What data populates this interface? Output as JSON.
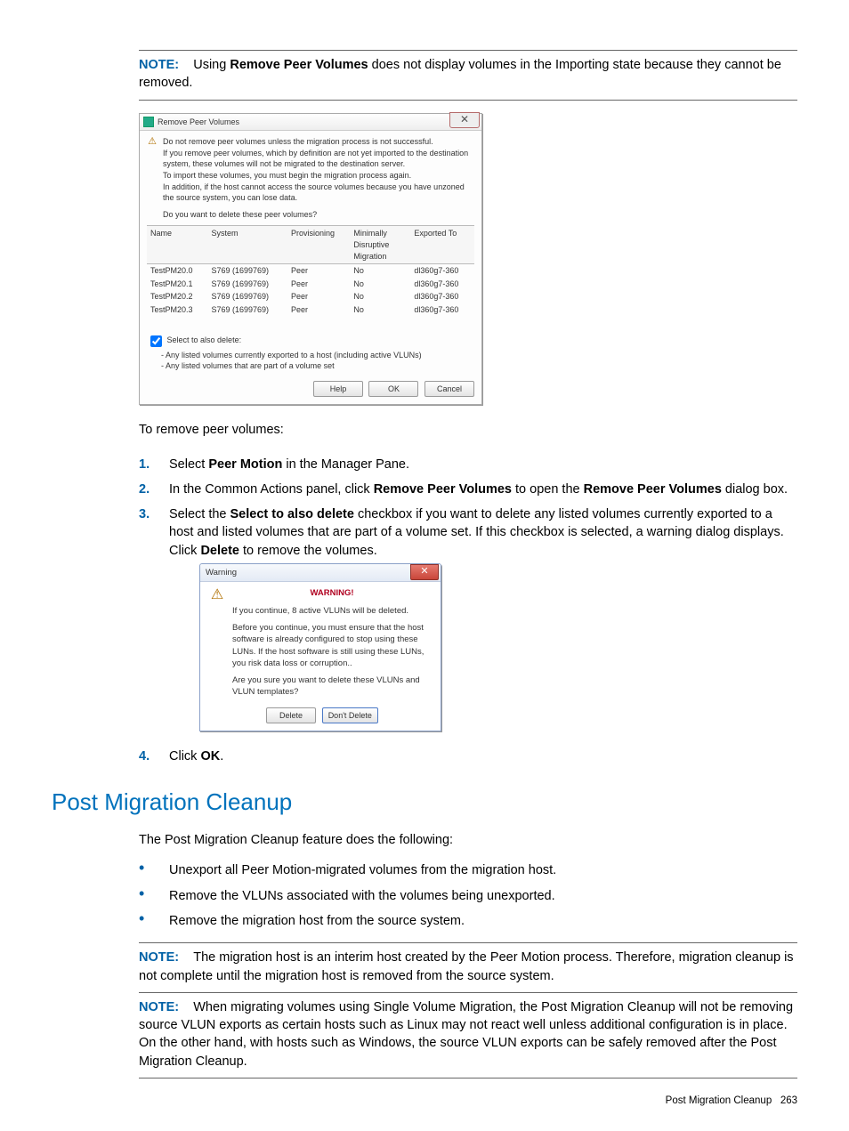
{
  "note_top": {
    "label": "NOTE:",
    "pre": "Using ",
    "bold": "Remove Peer Volumes",
    "post": " does not display volumes in the Importing state because they cannot be removed."
  },
  "dialog1": {
    "title": "Remove Peer Volumes",
    "warn_lines": {
      "l1": "Do not remove peer volumes unless the migration process is not successful.",
      "l2": "If you remove peer volumes, which by definition are not yet imported to the destination system, these volumes will not be migrated to the destination server.",
      "l3": "To import these volumes, you must begin the migration process again.",
      "l4": "In addition, if the host cannot access the source volumes because you have unzoned the source system, you can lose data."
    },
    "question": "Do you want to delete these peer volumes?",
    "headers": {
      "name": "Name",
      "system": "System",
      "prov": "Provisioning",
      "min": "Minimally Disruptive Migration",
      "exp": "Exported To"
    },
    "rows": [
      {
        "name": "TestPM20.0",
        "system": "S769 (1699769)",
        "prov": "Peer",
        "min": "No",
        "exp": "dl360g7-360"
      },
      {
        "name": "TestPM20.1",
        "system": "S769 (1699769)",
        "prov": "Peer",
        "min": "No",
        "exp": "dl360g7-360"
      },
      {
        "name": "TestPM20.2",
        "system": "S769 (1699769)",
        "prov": "Peer",
        "min": "No",
        "exp": "dl360g7-360"
      },
      {
        "name": "TestPM20.3",
        "system": "S769 (1699769)",
        "prov": "Peer",
        "min": "No",
        "exp": "dl360g7-360"
      }
    ],
    "check_label": "Select to also delete:",
    "check_sub1": "- Any listed volumes currently exported to a host (including active VLUNs)",
    "check_sub2": "- Any listed volumes that are part of a volume set",
    "btn_help": "Help",
    "btn_ok": "OK",
    "btn_cancel": "Cancel"
  },
  "intro": "To remove peer volumes:",
  "steps": {
    "s1": {
      "pre": "Select ",
      "bold": "Peer Motion",
      "post": " in the Manager Pane."
    },
    "s2": {
      "pre": "In the Common Actions panel, click ",
      "b1": "Remove Peer Volumes",
      "mid": " to open the ",
      "b2": "Remove Peer Volumes",
      "post": " dialog box."
    },
    "s3": {
      "pre": "Select the ",
      "b1": "Select to also delete",
      "mid": " checkbox if you want to delete any listed volumes currently exported to a host and listed volumes that are part of a volume set. If this checkbox is selected, a warning dialog displays. Click ",
      "b2": "Delete",
      "post": " to remove the volumes."
    },
    "s4": {
      "pre": "Click ",
      "bold": "OK",
      "post": "."
    }
  },
  "warn_dialog": {
    "title": "Warning",
    "heading": "WARNING!",
    "l1": "If you continue, 8 active VLUNs will be deleted.",
    "l2": "Before you continue, you must ensure that the host software is already configured to stop using these LUNs. If the host software is still using these LUNs, you risk data loss or corruption..",
    "l3": "Are you sure you want to delete these VLUNs and VLUN templates?",
    "btn_delete": "Delete",
    "btn_dont": "Don't Delete"
  },
  "section": {
    "title": "Post Migration Cleanup",
    "intro": "The Post Migration Cleanup feature does the following:",
    "b1": "Unexport all Peer Motion-migrated volumes from the migration host.",
    "b2": "Remove the VLUNs associated with the volumes being unexported.",
    "b3": "Remove the migration host from the source system."
  },
  "note2": {
    "label": "NOTE:",
    "text": "The migration host is an interim host created by the Peer Motion process. Therefore, migration cleanup is not complete until the migration host is removed from the source system."
  },
  "note3": {
    "label": "NOTE:",
    "text": "When migrating volumes using Single Volume Migration, the Post Migration Cleanup will not be removing source VLUN exports as certain hosts such as Linux may not react well unless additional configuration is in place. On the other hand, with hosts such as Windows, the source VLUN exports can be safely removed after the Post Migration Cleanup."
  },
  "footer": {
    "text": "Post Migration Cleanup",
    "page": "263"
  }
}
